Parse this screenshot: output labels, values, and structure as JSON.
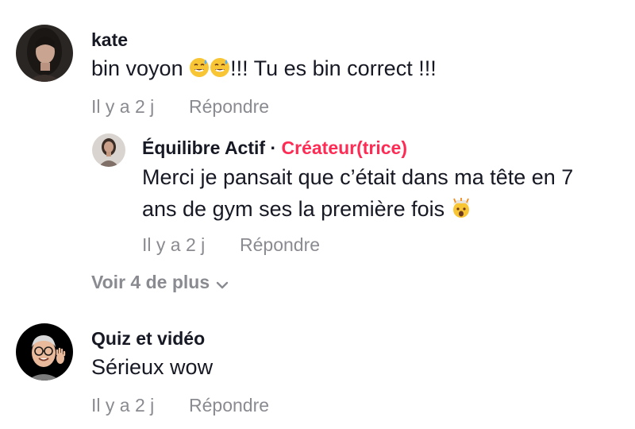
{
  "comments": [
    {
      "username": "kate",
      "text": "bin voyon",
      "text_after_emoji": "!!! Tu es bin correct !!!",
      "emoji": [
        "grinning-sweat-emoji",
        "grinning-sweat-emoji"
      ],
      "time": "Il y a 2 j",
      "reply_label": "Répondre",
      "replies": [
        {
          "username": "Équilibre Actif",
          "separator": "·",
          "creator_label": "Créateur(trice)",
          "text_line1": "Merci je pansait que c’était dans ma tête en 7",
          "text_line2": "ans de gym ses la première fois",
          "emoji": "exploding-head-emoji",
          "time": "Il y a 2 j",
          "reply_label": "Répondre"
        }
      ],
      "more_label": "Voir 4 de plus"
    },
    {
      "username": "Quiz et vidéo",
      "text": "Sérieux wow",
      "time": "Il y a 2 j",
      "reply_label": "Répondre"
    }
  ],
  "colors": {
    "creator": "#fe2c55",
    "meta": "#8a8b91",
    "text": "#161823"
  }
}
